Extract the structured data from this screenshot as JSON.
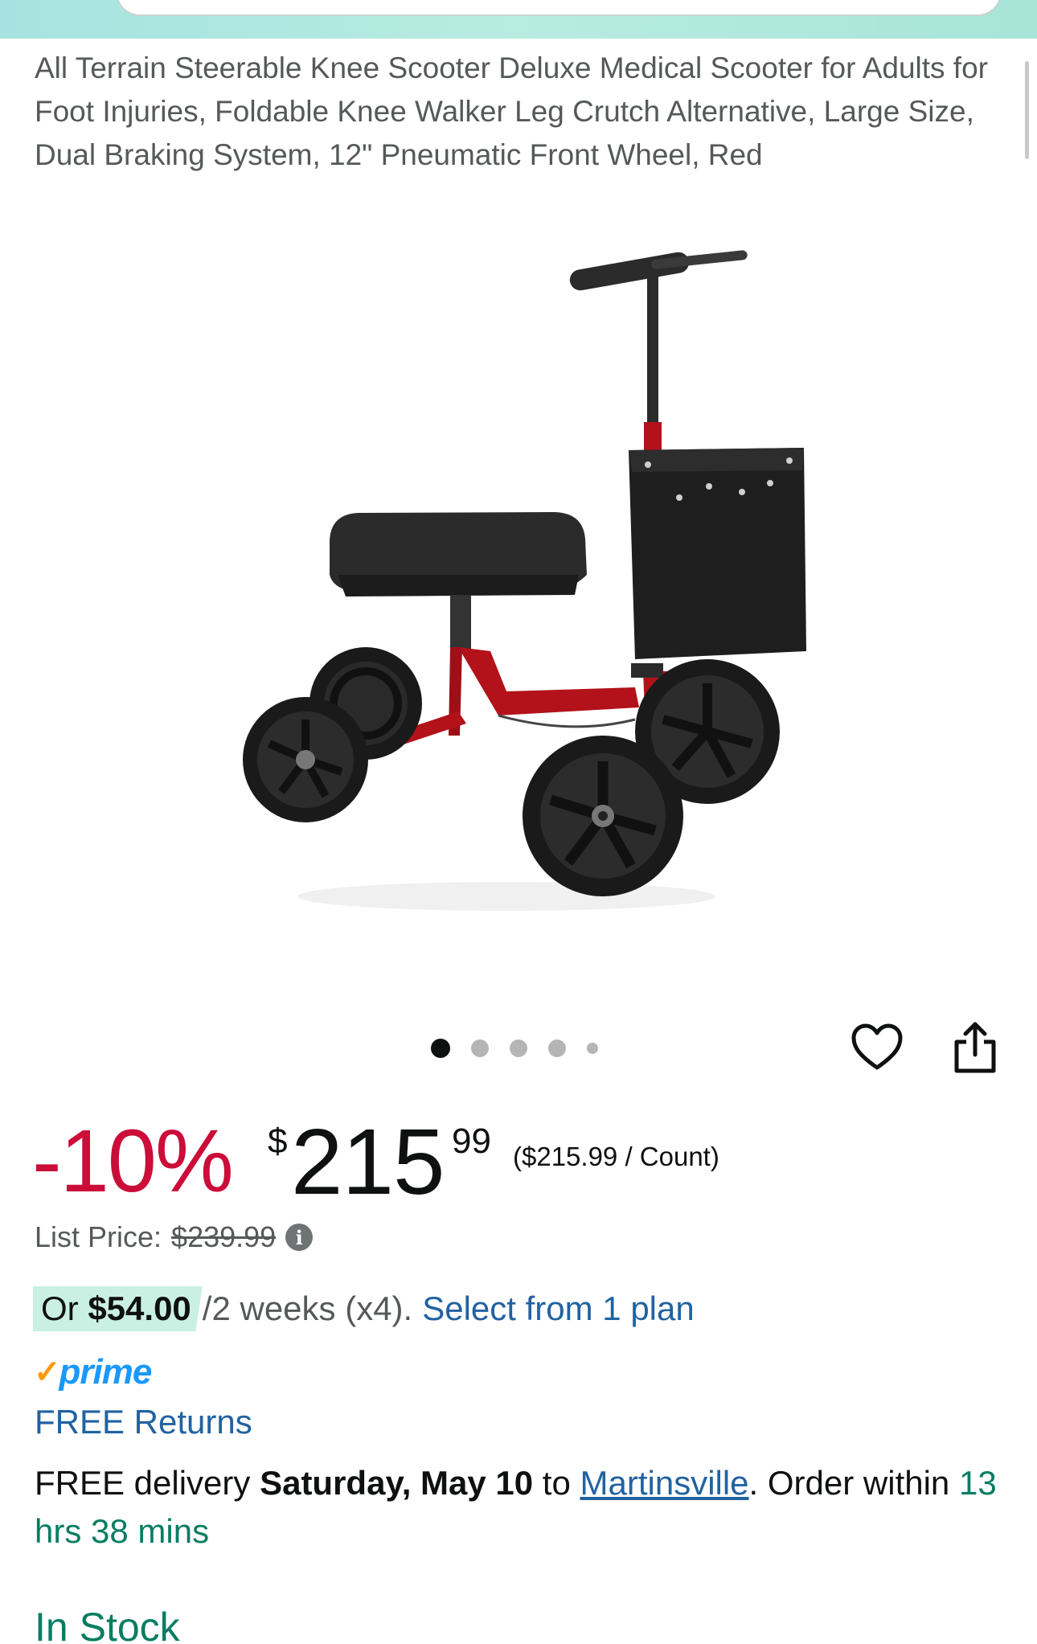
{
  "header": {
    "search_placeholder": ""
  },
  "product": {
    "title": "All Terrain Steerable Knee Scooter Deluxe Medical Scooter for Adults for Foot Injuries, Foldable Knee Walker Leg Crutch Alternative, Large Size, Dual Braking System, 12\" Pneumatic Front Wheel, Red",
    "image_description_icon": "knee-scooter-image",
    "carousel": {
      "count": 5,
      "active_index": 0
    }
  },
  "price": {
    "discount": "-10%",
    "currency_symbol": "$",
    "whole": "215",
    "fraction": "99",
    "unit_price": "($215.99 / Count)",
    "list_price_label": "List Price:",
    "list_price_value": "$239.99"
  },
  "installment": {
    "prefix": "Or ",
    "amount": "$54.00",
    "terms": "/2 weeks (x4).",
    "link": "Select from 1 plan"
  },
  "prime": {
    "check": "✓",
    "word": "prime"
  },
  "returns": {
    "label": "FREE Returns"
  },
  "delivery": {
    "prefix": "FREE delivery ",
    "date": "Saturday, May 10",
    "to": " to ",
    "location": "Martinsville",
    "order_within": ". Order within ",
    "countdown": "13 hrs 38 mins"
  },
  "stock": {
    "status": "In Stock"
  },
  "colors": {
    "discount_red": "#cc0c39",
    "link_blue": "#2162a1",
    "prime_blue": "#1a98ff",
    "prime_orange": "#ff9900",
    "stock_green": "#067d62",
    "highlight_mint": "#c9f0e3",
    "scooter_frame_red": "#b3121b"
  }
}
